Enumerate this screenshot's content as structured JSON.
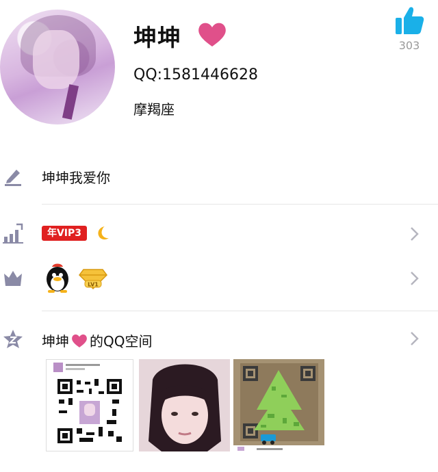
{
  "profile": {
    "name": "坤坤",
    "qq": "QQ:1581446628",
    "zodiac": "摩羯座"
  },
  "like": {
    "count": "303"
  },
  "rows": {
    "signature": "坤坤我爱你",
    "vip_badge": "年VIP3",
    "space_title_prefix": "坤坤",
    "space_title_suffix": "的QQ空间"
  },
  "colors": {
    "accent_blue": "#1ab0e8",
    "heart_pink": "#e0508a",
    "vip_red": "#e02020"
  },
  "icons": {
    "signature": "pencil-icon",
    "vip": "rising-bars-icon",
    "level": "crown-icon",
    "space": "star-z-icon"
  }
}
